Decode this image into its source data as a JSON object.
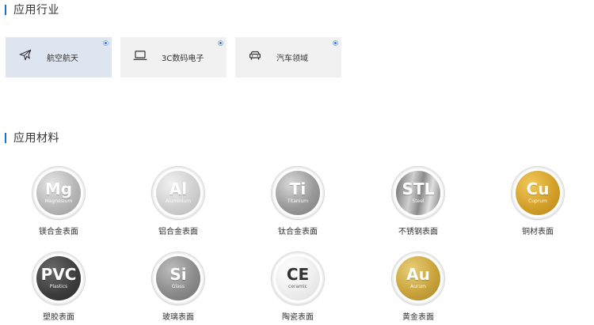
{
  "sections": {
    "industry_title": "应用行业",
    "materials_title": "应用材料"
  },
  "industries": [
    {
      "label": "航空航天",
      "icon": "airplane-icon",
      "selected": true
    },
    {
      "label": "3C数码电子",
      "icon": "laptop-icon",
      "selected": false
    },
    {
      "label": "汽车领域",
      "icon": "car-icon",
      "selected": false
    }
  ],
  "materials": [
    {
      "symbol": "Mg",
      "name": "Magnesium",
      "caption": "镁合金表面"
    },
    {
      "symbol": "Al",
      "name": "Aluminium",
      "caption": "铝合金表面"
    },
    {
      "symbol": "Ti",
      "name": "Titanium",
      "caption": "钛合金表面"
    },
    {
      "symbol": "STL",
      "name": "Steel",
      "caption": "不锈钢表面"
    },
    {
      "symbol": "Cu",
      "name": "Cuprum",
      "caption": "铜材表面"
    },
    {
      "symbol": "PVC",
      "name": "Plastics",
      "caption": "塑胶表面"
    },
    {
      "symbol": "Si",
      "name": "Glass",
      "caption": "玻璃表面"
    },
    {
      "symbol": "CE",
      "name": "ceramic",
      "caption": "陶瓷表面"
    },
    {
      "symbol": "Au",
      "name": "Aurum",
      "caption": "黄金表面"
    }
  ],
  "colors": {
    "accent": "#1f6fd0",
    "selected_card": "#dfe5f0",
    "card": "#f1f1f1"
  }
}
